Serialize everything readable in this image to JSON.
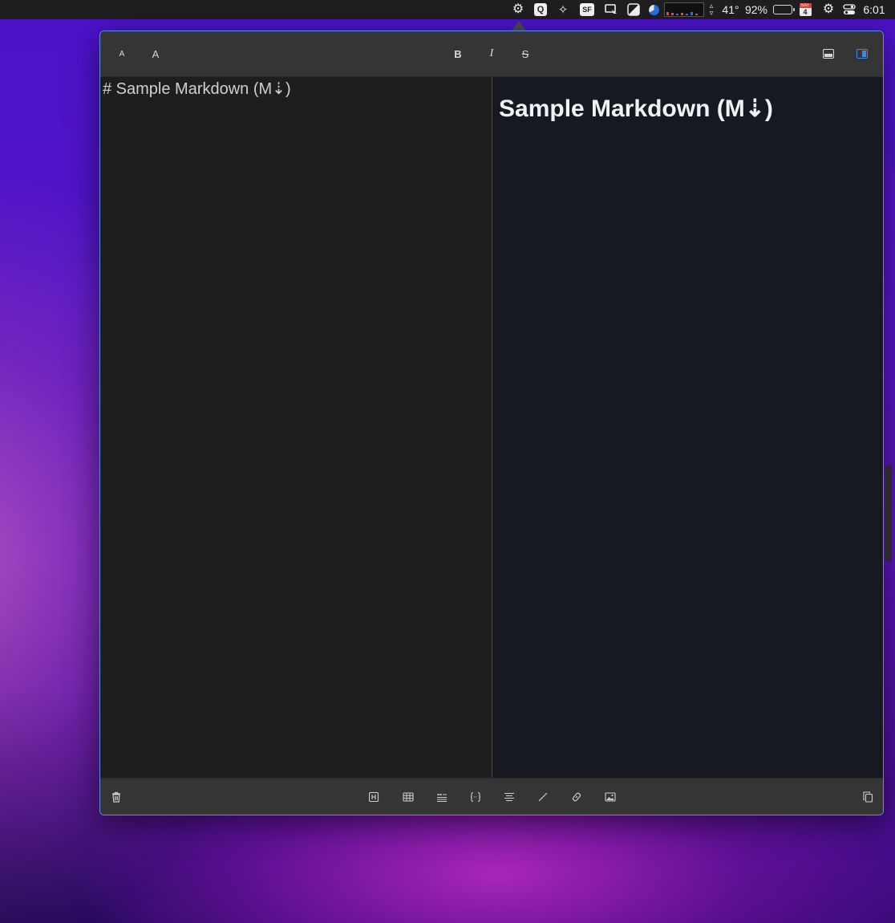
{
  "menubar": {
    "temperature": "41°",
    "battery_percent": "92%",
    "calendar_day": "SAT",
    "calendar_date": "4",
    "time": "6:01",
    "icons": [
      "markdown-app-gear-icon",
      "q-icon",
      "sparkle-icon",
      "sf-icon",
      "screen-icon",
      "contrast-icon",
      "pie-icon",
      "network-graph-icon",
      "updown-arrows-icon",
      "battery-icon",
      "calendar-icon",
      "settings-gear-icon",
      "control-center-icon"
    ]
  },
  "toolbar": {
    "font_small": "A",
    "font_large": "A",
    "bold": "B",
    "italic": "I",
    "strikethrough": "S"
  },
  "editor": {
    "text": "# Sample Markdown (M⇣)"
  },
  "preview": {
    "heading": "Sample Markdown (M⇣)"
  },
  "bottombar": {
    "icons": [
      "trash-icon",
      "heading-icon",
      "table-icon",
      "quote-list-icon",
      "code-block-icon",
      "align-icon",
      "divider-slash-icon",
      "link-icon",
      "image-icon",
      "copy-icon"
    ]
  },
  "colors": {
    "accent": "#3a8af5",
    "toolbar_bg": "#353535",
    "editor_bg": "#1e1e1e",
    "preview_bg": "#161a20"
  }
}
